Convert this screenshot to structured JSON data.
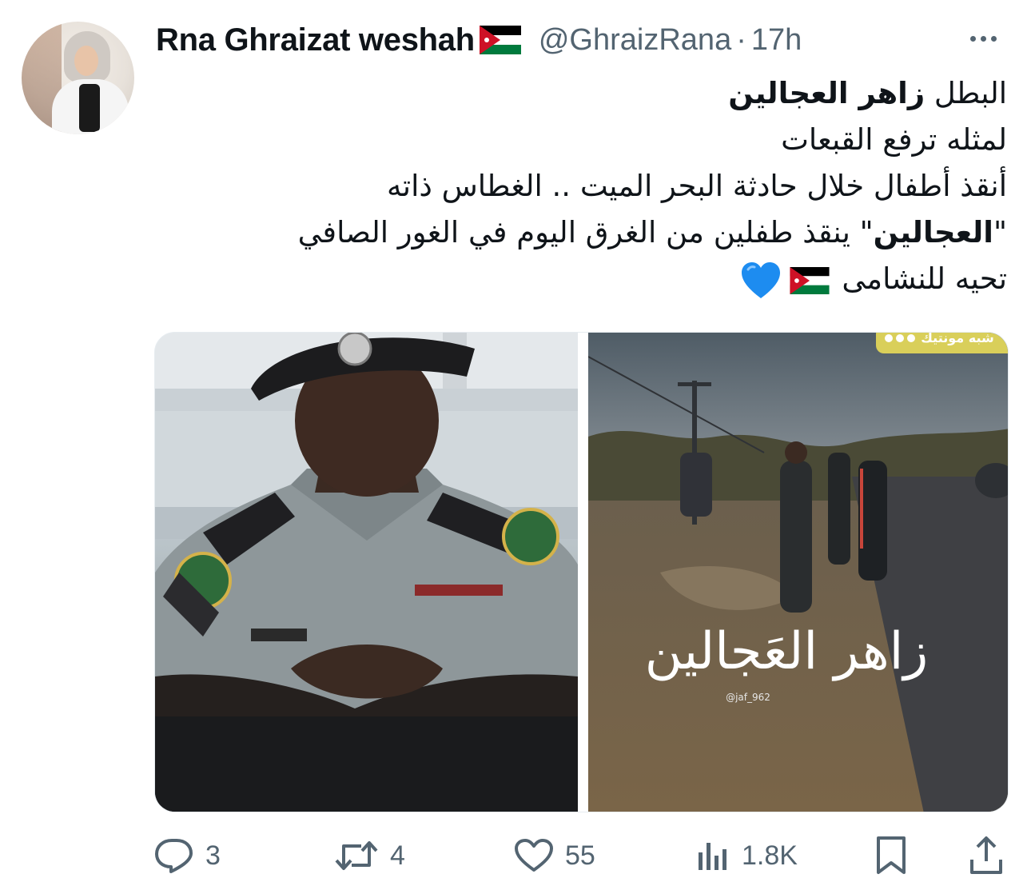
{
  "tweet": {
    "author": {
      "display_name": "Rna Ghraizat weshah",
      "handle": "@GhraizRana",
      "separator": "·",
      "time": "17h",
      "flag_icon": "jordan-flag-icon"
    },
    "text_lines": [
      {
        "prefix": "البطل ",
        "bold": "زاهر العجالين",
        "suffix": ""
      },
      {
        "prefix": "لمثله ترفع القبعات",
        "bold": "",
        "suffix": ""
      },
      {
        "prefix": "أنقذ أطفال خلال حادثة البحر الميت .. الغطاس ذاته",
        "bold": "",
        "suffix": ""
      },
      {
        "prefix": "\"",
        "bold": "العجالين",
        "suffix": "\" ينقذ طفلين من الغرق اليوم في الغور الصافي"
      },
      {
        "prefix": "تحيه للنشامى ",
        "bold": "",
        "suffix": ""
      }
    ],
    "media": {
      "image_left": "soldier-photo",
      "image_right": {
        "overlay_title": "زاهر العَجالين",
        "watermark": "@jaf_962",
        "corner_badge": "شبه مونتيك"
      }
    },
    "actions": {
      "replies": "3",
      "retweets": "4",
      "likes": "55",
      "views": "1.8K"
    }
  },
  "colors": {
    "text_primary": "#0f1419",
    "text_secondary": "#536471",
    "heart_blue": "#1d8cf0",
    "flag_black": "#000000",
    "flag_white": "#ffffff",
    "flag_green": "#007a3d",
    "flag_red": "#ce1126"
  }
}
